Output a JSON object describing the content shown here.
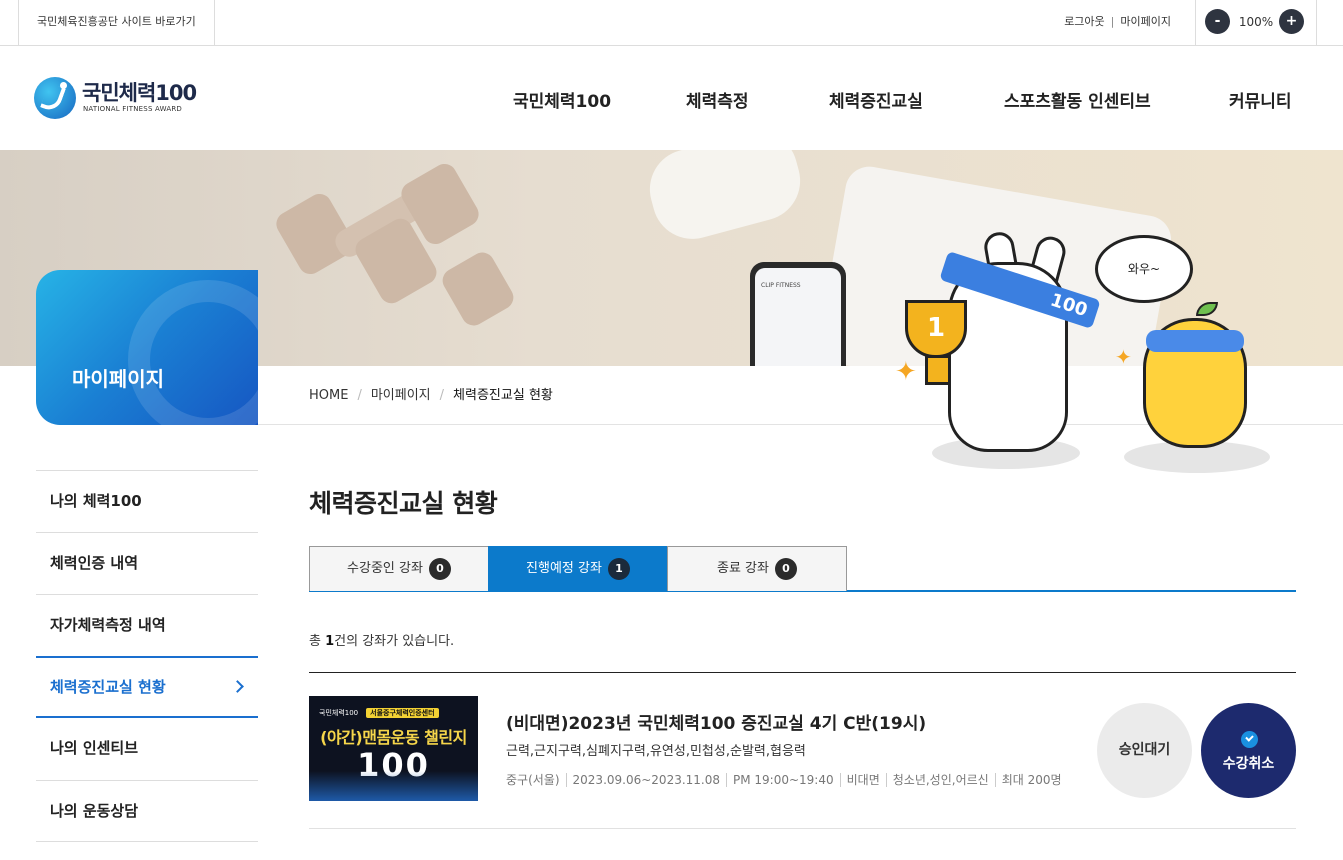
{
  "utility": {
    "site_link": "국민체육진흥공단 사이트 바로가기",
    "logout": "로그아웃",
    "mypage": "마이페이지",
    "zoom_minus": "-",
    "zoom_value": "100%",
    "zoom_plus": "+"
  },
  "logo": {
    "title": "국민체력100",
    "subtitle": "NATIONAL FITNESS AWARD"
  },
  "gnb": [
    "국민체력100",
    "체력측정",
    "체력증진교실",
    "스포츠활동 인센티브",
    "커뮤니티"
  ],
  "hero": {
    "phone_text": "CLIP FITNESS",
    "bubble": "와우~",
    "headband_text": "100",
    "trophy_text": "1"
  },
  "side_title": "마이페이지",
  "breadcrumb": [
    "HOME",
    "마이페이지",
    "체력증진교실 현황"
  ],
  "lnb": [
    {
      "label": "나의 체력100"
    },
    {
      "label": "체력인증 내역"
    },
    {
      "label": "자가체력측정 내역"
    },
    {
      "label": "체력증진교실 현황",
      "active": true
    },
    {
      "label": "나의 인센티브"
    },
    {
      "label": "나의 운동상담"
    }
  ],
  "page_title": "체력증진교실 현황",
  "tabs": [
    {
      "label": "수강중인 강좌",
      "count": "0"
    },
    {
      "label": "진행예정 강좌",
      "count": "1",
      "active": true
    },
    {
      "label": "종료 강좌",
      "count": "0"
    }
  ],
  "total": {
    "prefix": "총 ",
    "count": "1",
    "suffix": "건의 강좌가 있습니다."
  },
  "course": {
    "thumb_brand": "국민체력100",
    "thumb_center": "서울중구체력인증센터",
    "thumb_title": "(야간)맨몸운동 챌린지",
    "thumb_number": "100",
    "title": "(비대면)2023년 국민체력100 증진교실 4기 C반(19시)",
    "tags": "근력,근지구력,심폐지구력,유연성,민첩성,순발력,협응력",
    "meta": [
      "중구(서울)",
      "2023.09.06~2023.11.08",
      "PM 19:00~19:40",
      "비대면",
      "청소년,성인,어르신",
      "최대 200명"
    ],
    "status": "승인대기",
    "cancel": "수강취소"
  },
  "colors": {
    "accent": "#0c7acb",
    "lnb_active": "#1a6fcf",
    "cancel_bg": "#1d2a6e"
  }
}
